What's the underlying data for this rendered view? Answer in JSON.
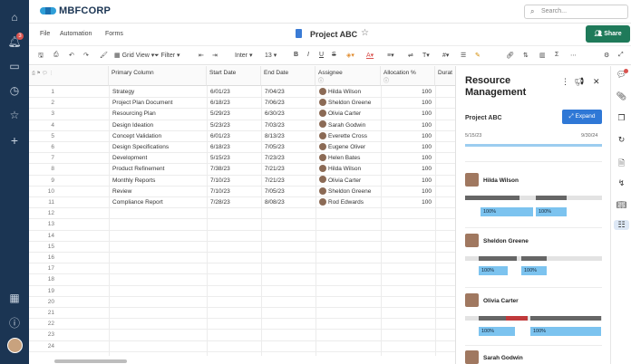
{
  "app": {
    "brand": "MBFCORP"
  },
  "search": {
    "placeholder": "Search..."
  },
  "leftnav": {
    "notification_count": "3"
  },
  "menu": {
    "file": "File",
    "automation": "Automation",
    "forms": "Forms"
  },
  "document": {
    "title": "Project ABC"
  },
  "share": {
    "label": "Share"
  },
  "toolbar": {
    "view": "Grid View",
    "filter": "Filter",
    "font": "Inter",
    "size": "13"
  },
  "grid": {
    "columns": [
      "Primary Column",
      "Start Date",
      "End Date",
      "Assignee",
      "Allocation %",
      "Durat"
    ],
    "rows": [
      {
        "n": "1",
        "task": "Strategy",
        "start": "6/01/23",
        "end": "7/04/23",
        "assignee": "Hilda Wilson",
        "alloc": "100"
      },
      {
        "n": "2",
        "task": "Project Plan Document",
        "start": "6/18/23",
        "end": "7/06/23",
        "assignee": "Sheldon Greene",
        "alloc": "100"
      },
      {
        "n": "3",
        "task": "Resourcing Plan",
        "start": "5/29/23",
        "end": "6/30/23",
        "assignee": "Olivia Carter",
        "alloc": "100"
      },
      {
        "n": "4",
        "task": "Design Ideation",
        "start": "5/23/23",
        "end": "7/03/23",
        "assignee": "Sarah Godwin",
        "alloc": "100"
      },
      {
        "n": "5",
        "task": "Concept Validation",
        "start": "6/01/23",
        "end": "8/13/23",
        "assignee": "Everette Cross",
        "alloc": "100"
      },
      {
        "n": "6",
        "task": "Design Specifications",
        "start": "6/18/23",
        "end": "7/05/23",
        "assignee": "Eugene Oliver",
        "alloc": "100"
      },
      {
        "n": "7",
        "task": "Development",
        "start": "5/15/23",
        "end": "7/23/23",
        "assignee": "Helen Bates",
        "alloc": "100"
      },
      {
        "n": "8",
        "task": "Product Refinement",
        "start": "7/38/23",
        "end": "7/21/23",
        "assignee": "Hilda Wilson",
        "alloc": "100"
      },
      {
        "n": "9",
        "task": "Monthly Reports",
        "start": "7/10/23",
        "end": "7/21/23",
        "assignee": "Olivia Carter",
        "alloc": "100"
      },
      {
        "n": "10",
        "task": "Review",
        "start": "7/10/23",
        "end": "7/05/23",
        "assignee": "Sheldon Greene",
        "alloc": "100"
      },
      {
        "n": "11",
        "task": "Compliance Report",
        "start": "7/28/23",
        "end": "8/08/23",
        "assignee": "Rod Edwards",
        "alloc": "100"
      }
    ],
    "empty_rows": [
      "12",
      "13",
      "14",
      "15",
      "16",
      "17",
      "18",
      "19",
      "20",
      "21",
      "22",
      "23",
      "24"
    ]
  },
  "panel": {
    "title": "Resource Management",
    "project": "Project ABC",
    "expand": "Expand",
    "date_start": "5/15/23",
    "date_end": "9/30/24",
    "people": [
      {
        "name": "Hilda Wilson",
        "pcts": [
          "100%",
          "100%"
        ]
      },
      {
        "name": "Sheldon Greene",
        "pcts": [
          "100%",
          "100%"
        ]
      },
      {
        "name": "Olivia Carter",
        "pcts": [
          "100%",
          "100%"
        ]
      },
      {
        "name": "Sarah Godwin",
        "pcts": []
      }
    ]
  },
  "colors": {
    "nav": "#1b3553",
    "accent": "#2f78d6",
    "share": "#1f7a5a",
    "alloc_bar": "#7cc3ef",
    "overalloc": "#c0393b"
  }
}
